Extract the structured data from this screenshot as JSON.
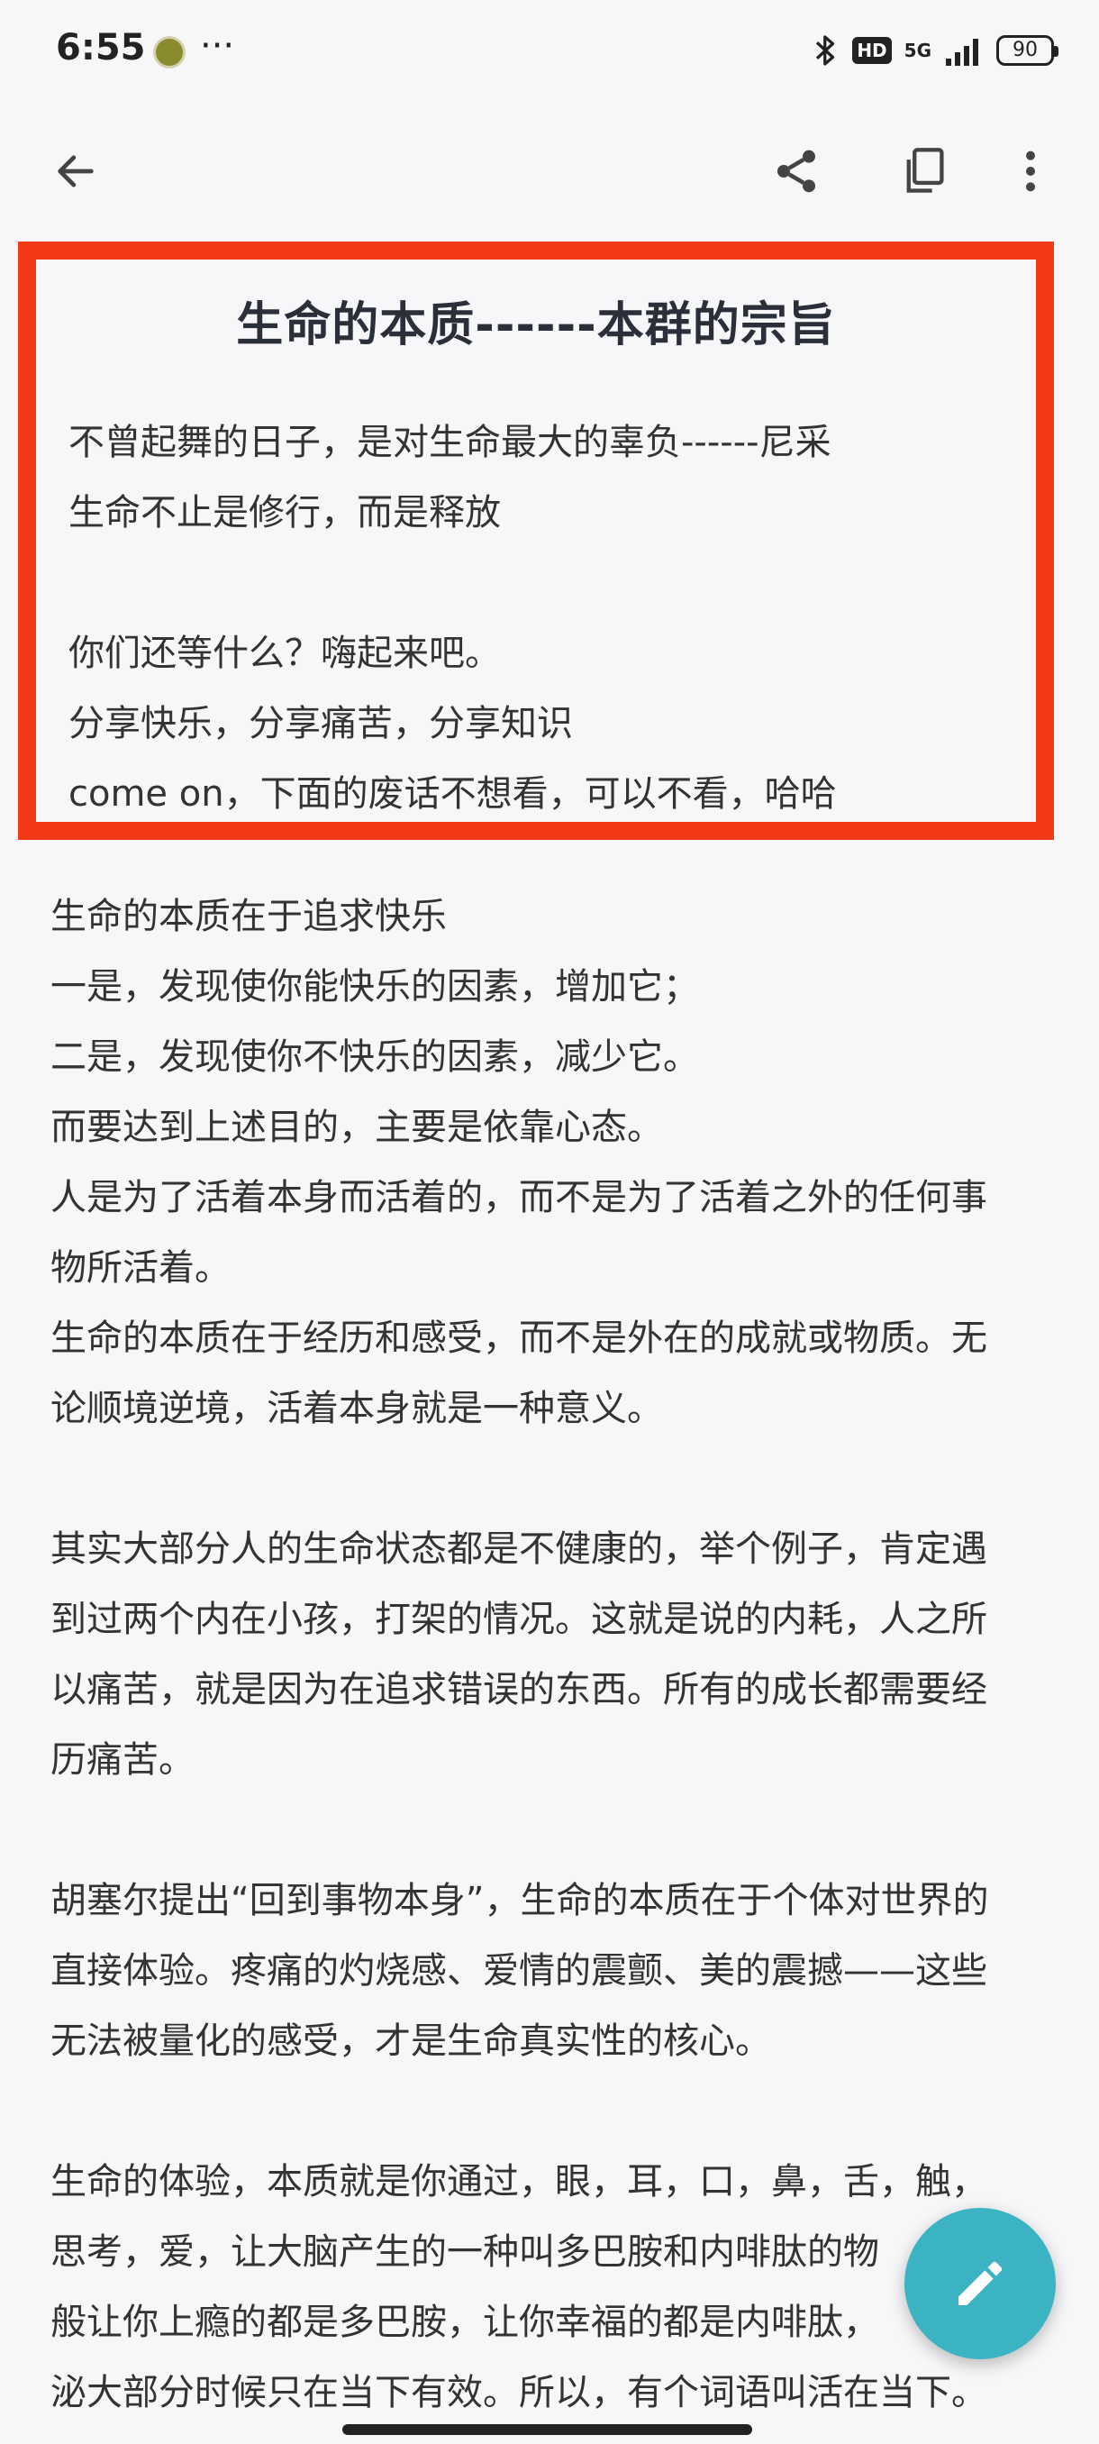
{
  "status_bar": {
    "time": "6:55",
    "more": "···",
    "hd": "HD",
    "network": "5G",
    "battery": "90"
  },
  "app_bar": {
    "back_icon": "arrow-left",
    "share_icon": "share",
    "copy_icon": "copy",
    "menu_icon": "more-vertical"
  },
  "note": {
    "title": "生命的本质------本群的宗旨",
    "intro_lines": [
      "不曾起舞的日子，是对生命最大的辜负------尼采",
      "生命不止是修行，而是释放",
      "你们还等什么？嗨起来吧。",
      "分享快乐，分享痛苦，分享知识",
      "come on，下面的废话不想看，可以不看，哈哈"
    ],
    "body_lines": [
      "生命的本质在于追求快乐",
      "一是，发现使你能快乐的因素，增加它；",
      "二是，发现使你不快乐的因素，减少它。",
      "而要达到上述目的，主要是依靠心态。",
      "人是为了活着本身而活着的，而不是为了活着之外的任何事",
      "物所活着。",
      "生命的本质在于经历和感受，而不是外在的成就或物质。无",
      "论顺境逆境，活着本身就是一种意义。",
      "",
      "其实大部分人的生命状态都是不健康的，举个例子，肯定遇",
      "到过两个内在小孩，打架的情况。这就是说的内耗，人之所",
      "以痛苦，就是因为在追求错误的东西。所有的成长都需要经",
      "历痛苦。",
      "",
      "胡塞尔提出“回到事物本身”，生命的本质在于个体对世界的",
      "直接体验。疼痛的灼烧感、爱情的震颤、美的震撼——这些",
      "无法被量化的感受，才是生命真实性的核心。",
      "",
      "生命的体验，本质就是你通过，眼，耳，口，鼻，舌，触，",
      "思考，爱，让大脑产生的一种叫多巴胺和内啡肽的物",
      "般让你上瘾的都是多巴胺，让你幸福的都是内啡肽，",
      "泌大部分时候只在当下有效。所以，有个词语叫活在当下。"
    ]
  },
  "fab": {
    "icon": "pencil-edit",
    "color": "#3cb3c2"
  },
  "colors": {
    "highlight_border": "#f23a17",
    "background": "#f7f7f9"
  }
}
